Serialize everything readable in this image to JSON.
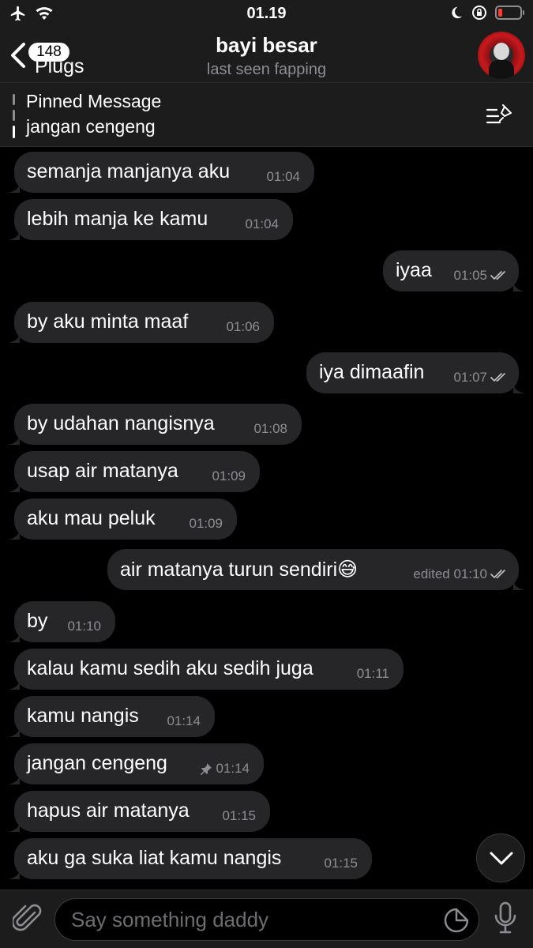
{
  "status_bar": {
    "time": "01.19",
    "icons": [
      "airplane-icon",
      "wifi-icon",
      "moon-icon",
      "orientation-lock-icon",
      "battery-icon"
    ],
    "battery_color": "#ff3b30"
  },
  "header": {
    "back_count": "148",
    "back_label": "Plugs",
    "title": "bayi besar",
    "subtitle": "last seen fapping"
  },
  "pinned": {
    "label": "Pinned Message",
    "text": "jangan cengeng"
  },
  "messages": [
    {
      "dir": "in",
      "text": "semanja manjanya aku",
      "time": "01:04"
    },
    {
      "dir": "in",
      "text": "lebih manja ke kamu",
      "time": "01:04"
    },
    {
      "dir": "out",
      "text": "iyaa",
      "time": "01:05",
      "read": true
    },
    {
      "dir": "in",
      "text": "by aku minta maaf",
      "time": "01:06"
    },
    {
      "dir": "out",
      "text": "iya dimaafin",
      "time": "01:07",
      "read": true
    },
    {
      "dir": "in",
      "text": "by udahan nangisnya",
      "time": "01:08"
    },
    {
      "dir": "in",
      "text": "usap air matanya",
      "time": "01:09"
    },
    {
      "dir": "in",
      "text": "aku mau peluk",
      "time": "01:09"
    },
    {
      "dir": "out",
      "text": "air matanya turun sendiri😅",
      "time": "edited 01:10",
      "read": true
    },
    {
      "dir": "in",
      "text": "by",
      "time": "01:10"
    },
    {
      "dir": "in",
      "text": "kalau kamu sedih aku sedih juga",
      "time": "01:11"
    },
    {
      "dir": "in",
      "text": "kamu nangis",
      "time": "01:14"
    },
    {
      "dir": "in",
      "text": "jangan cengeng",
      "time": "01:14",
      "pinned": true
    },
    {
      "dir": "in",
      "text": "hapus air matanya",
      "time": "01:15"
    },
    {
      "dir": "in",
      "text": "aku ga suka liat kamu nangis",
      "time": "01:15"
    }
  ],
  "input": {
    "placeholder": "Say something daddy",
    "value": ""
  },
  "colors": {
    "background": "#000000",
    "bar": "#1c1c1d",
    "bubble": "#262628",
    "secondary_text": "#8d8e93"
  }
}
